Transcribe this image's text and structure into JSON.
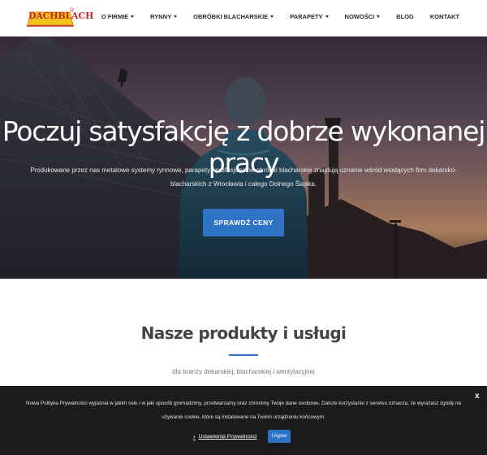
{
  "header": {
    "logo_text": "DACHBLACH",
    "logo_mark": "®",
    "nav": [
      {
        "label": "O FIRMIE",
        "dropdown": true
      },
      {
        "label": "RYNNY",
        "dropdown": true
      },
      {
        "label": "OBRÓBKI BLACHARSKIE",
        "dropdown": true
      },
      {
        "label": "PARAPETY",
        "dropdown": true
      },
      {
        "label": "NOWOŚCI",
        "dropdown": true
      },
      {
        "label": "BLOG",
        "dropdown": false
      },
      {
        "label": "KONTAKT",
        "dropdown": false
      }
    ]
  },
  "hero": {
    "title": "Poczuj satysfakcję z dobrze wykonanej pracy",
    "subtitle": "Produkowane przez nas metalowe systemy rynnowe, parapety i profesjonalne obróbki blacharskie znajdują uznanie wśród wiodących firm dekarsko-blacharskich z Wrocławia i całego Dolnego Śląska.",
    "button": "SPRAWDŹ CENY"
  },
  "products": {
    "title": "Nasze produkty i usługi",
    "subtitle": "dla branży dekarskiej, blacharskiej i wentylacyjnej"
  },
  "cookie": {
    "text": "Nowa Polityka Prywatności wyjaśnia w jakim celu i w jaki sposób gromadzimy, przetwarzamy oraz chronimy Twoje dane osobowe. Dalsze korzystanie z serwisu oznacza, że wyrażasz zgodę na używanie cookie, które są instalowane na Twoim urządzeniu końcowym.",
    "close": "x",
    "settings_label": "Ustawienia Prywatności",
    "agree_label": "I Agree"
  },
  "colors": {
    "accent": "#2f73c6",
    "logo": "#c62828"
  }
}
